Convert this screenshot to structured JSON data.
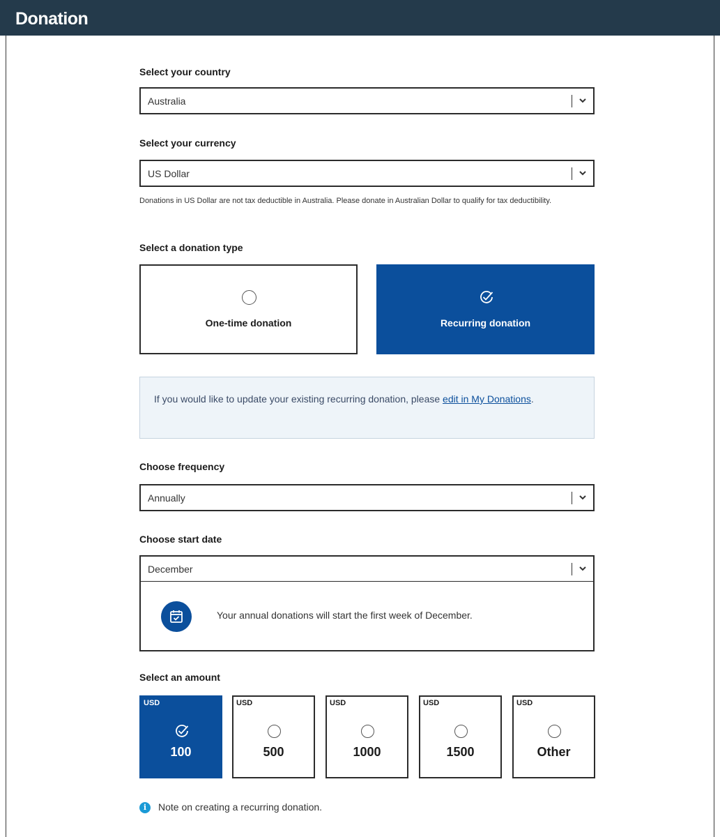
{
  "title": "Donation",
  "country": {
    "label": "Select your country",
    "value": "Australia"
  },
  "currency": {
    "label": "Select your currency",
    "value": "US Dollar",
    "helper": "Donations in US Dollar are not tax deductible in Australia. Please donate in Australian Dollar to qualify for tax deductibility."
  },
  "donation_type": {
    "label": "Select a donation type",
    "options": [
      {
        "label": "One-time donation",
        "selected": false
      },
      {
        "label": "Recurring donation",
        "selected": true
      }
    ]
  },
  "info": {
    "text_before": "If you would like to update your existing recurring donation, please ",
    "link": "edit in My Donations",
    "text_after": "."
  },
  "frequency": {
    "label": "Choose frequency",
    "value": "Annually"
  },
  "start_date": {
    "label": "Choose start date",
    "value": "December",
    "message": "Your annual donations will start the first week of December."
  },
  "amount": {
    "label": "Select an amount",
    "options": [
      {
        "currency": "USD",
        "value": "100",
        "selected": true
      },
      {
        "currency": "USD",
        "value": "500",
        "selected": false
      },
      {
        "currency": "USD",
        "value": "1000",
        "selected": false
      },
      {
        "currency": "USD",
        "value": "1500",
        "selected": false
      },
      {
        "currency": "USD",
        "value": "Other",
        "selected": false
      }
    ]
  },
  "note": {
    "text": "Note on creating a recurring donation."
  },
  "colors": {
    "header": "#243a4b",
    "accent": "#0b4f9c",
    "info_bg": "#eef4f9",
    "info_icon": "#1a9ad6"
  }
}
